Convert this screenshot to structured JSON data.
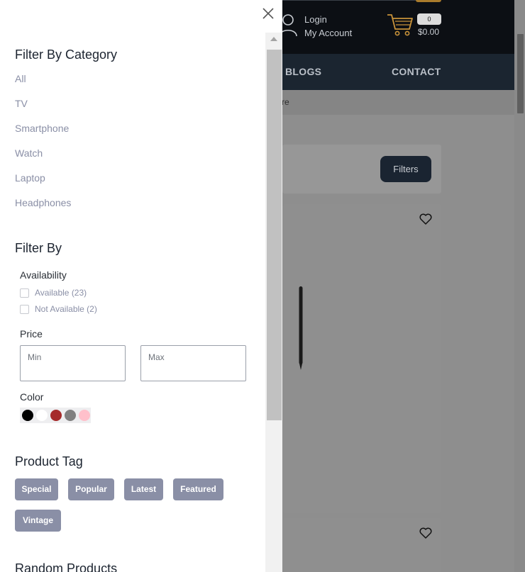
{
  "header": {
    "login_label": "Login",
    "account_label": "My Account",
    "cart_count": "0",
    "cart_total": "$0.00"
  },
  "nav": {
    "items": [
      "BLOGS",
      "CONTACT"
    ]
  },
  "breadcrumb": {
    "partial_text": "re"
  },
  "toolbar": {
    "filters_label": "Filters"
  },
  "panel": {
    "category_title": "Filter By Category",
    "categories": [
      "All",
      "TV",
      "Smartphone",
      "Watch",
      "Laptop",
      "Headphones"
    ],
    "filter_by_title": "Filter By",
    "availability": {
      "label": "Availability",
      "options": [
        "Available (23)",
        "Not Available (2)"
      ]
    },
    "price": {
      "label": "Price",
      "min_placeholder": "Min",
      "max_placeholder": "Max"
    },
    "color": {
      "label": "Color",
      "swatches": [
        "#000000",
        "#ffffff",
        "#a52a2a",
        "#808080",
        "#ffc0cb"
      ]
    },
    "product_tag_title": "Product Tag",
    "tags": [
      "Special",
      "Popular",
      "Latest",
      "Featured",
      "Vintage"
    ],
    "random_products_title": "Random Products"
  }
}
